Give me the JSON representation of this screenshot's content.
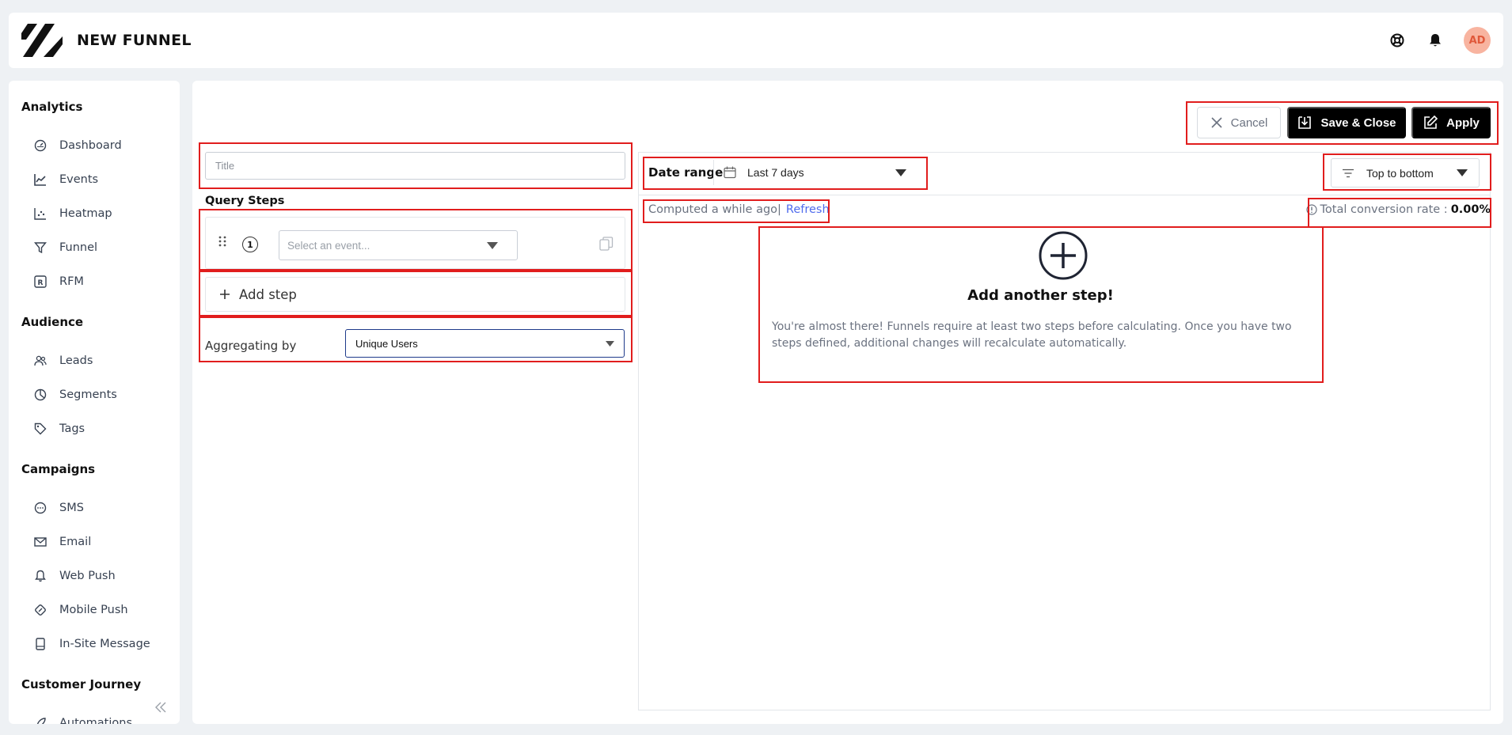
{
  "header": {
    "title": "NEW FUNNEL",
    "avatar_initials": "AD"
  },
  "sidebar": {
    "sections": [
      {
        "title": "Analytics",
        "items": [
          {
            "label": "Dashboard",
            "icon": "gauge-icon"
          },
          {
            "label": "Events",
            "icon": "chart-line-icon"
          },
          {
            "label": "Heatmap",
            "icon": "scatter-icon"
          },
          {
            "label": "Funnel",
            "icon": "funnel-icon"
          },
          {
            "label": "RFM",
            "icon": "rfm-icon"
          }
        ]
      },
      {
        "title": "Audience",
        "items": [
          {
            "label": "Leads",
            "icon": "users-icon"
          },
          {
            "label": "Segments",
            "icon": "pie-icon"
          },
          {
            "label": "Tags",
            "icon": "tag-icon"
          }
        ]
      },
      {
        "title": "Campaigns",
        "items": [
          {
            "label": "SMS",
            "icon": "chat-icon"
          },
          {
            "label": "Email",
            "icon": "mail-icon"
          },
          {
            "label": "Web Push",
            "icon": "bell-icon"
          },
          {
            "label": "Mobile Push",
            "icon": "mobile-push-icon"
          },
          {
            "label": "In-Site Message",
            "icon": "in-site-icon"
          }
        ]
      },
      {
        "title": "Customer Journey",
        "items": [
          {
            "label": "Automations",
            "icon": "rocket-icon"
          }
        ]
      }
    ]
  },
  "toolbar": {
    "cancel_label": "Cancel",
    "save_label": "Save & Close",
    "apply_label": "Apply"
  },
  "form": {
    "title_placeholder": "Title",
    "query_steps_label": "Query Steps",
    "step_number": "1",
    "event_placeholder": "Select an event...",
    "add_step_label": "Add step",
    "aggregating_label": "Aggregating by",
    "aggregating_value": "Unique Users"
  },
  "results": {
    "date_range_label": "Date range",
    "date_range_value": "Last 7 days",
    "order_value": "Top to bottom",
    "computed_text": "Computed a while ago|",
    "refresh_label": "Refresh",
    "conversion_label": "Total conversion rate :",
    "conversion_value": "0.00%",
    "empty_title": "Add another step!",
    "empty_desc": "You're almost there! Funnels require at least two steps before calculating. Once you have two steps defined, additional changes will recalculate automatically."
  },
  "colors": {
    "accent": "#000000",
    "link": "#4f6bed",
    "annotation": "#e11d1d"
  }
}
